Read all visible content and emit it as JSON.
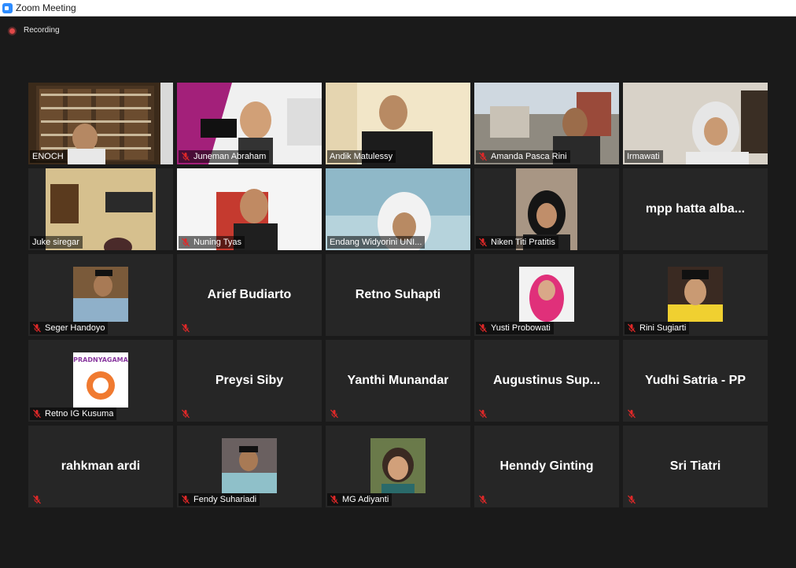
{
  "window": {
    "title": "Zoom Meeting"
  },
  "status": {
    "recording_label": "Recording"
  },
  "participants": [
    {
      "name": "ENOCH",
      "display": "video",
      "muted": false,
      "active": true
    },
    {
      "name": "Juneman Abraham",
      "display": "video",
      "muted": true
    },
    {
      "name": "Andik Matulessy",
      "display": "video",
      "muted": false
    },
    {
      "name": "Amanda Pasca Rini",
      "display": "video",
      "muted": true
    },
    {
      "name": "Irmawati",
      "display": "video",
      "muted": false
    },
    {
      "name": "Juke siregar",
      "display": "video",
      "muted": false
    },
    {
      "name": "Nuning Tyas",
      "display": "video",
      "muted": true
    },
    {
      "name": "Endang Widyorini UNI...",
      "display": "video",
      "muted": false
    },
    {
      "name": "Niken Titi Pratitis",
      "display": "video",
      "muted": true
    },
    {
      "name": "mpp hatta alba...",
      "display": "name",
      "muted": false
    },
    {
      "name": "Seger Handoyo",
      "display": "photo",
      "muted": true
    },
    {
      "name": "Arief Budiarto",
      "display": "name",
      "muted": true
    },
    {
      "name": "Retno Suhapti",
      "display": "name",
      "muted": false
    },
    {
      "name": "Yusti Probowati",
      "display": "photo",
      "muted": true
    },
    {
      "name": "Rini Sugiarti",
      "display": "photo",
      "muted": true
    },
    {
      "name": "Retno IG Kusuma",
      "display": "logo",
      "muted": true,
      "logo_text": "PRADNYAGAMA"
    },
    {
      "name": "Preysi Siby",
      "display": "name",
      "muted": true
    },
    {
      "name": "Yanthi Munandar",
      "display": "name",
      "muted": true
    },
    {
      "name": "Augustinus Sup...",
      "display": "name",
      "muted": true
    },
    {
      "name": "Yudhi Satria - PP",
      "display": "name",
      "muted": true
    },
    {
      "name": "rahkman ardi",
      "display": "name",
      "muted": true
    },
    {
      "name": "Fendy Suhariadi",
      "display": "photo",
      "muted": true
    },
    {
      "name": "MG Adiyanti",
      "display": "photo",
      "muted": true
    },
    {
      "name": "Henndy Ginting",
      "display": "name",
      "muted": true
    },
    {
      "name": "Sri Tiatri",
      "display": "name",
      "muted": true
    }
  ],
  "colors": {
    "background": "#1a1a1a",
    "tile": "#262626",
    "active_speaker": "#d5e27c",
    "muted_icon": "#e02828"
  }
}
